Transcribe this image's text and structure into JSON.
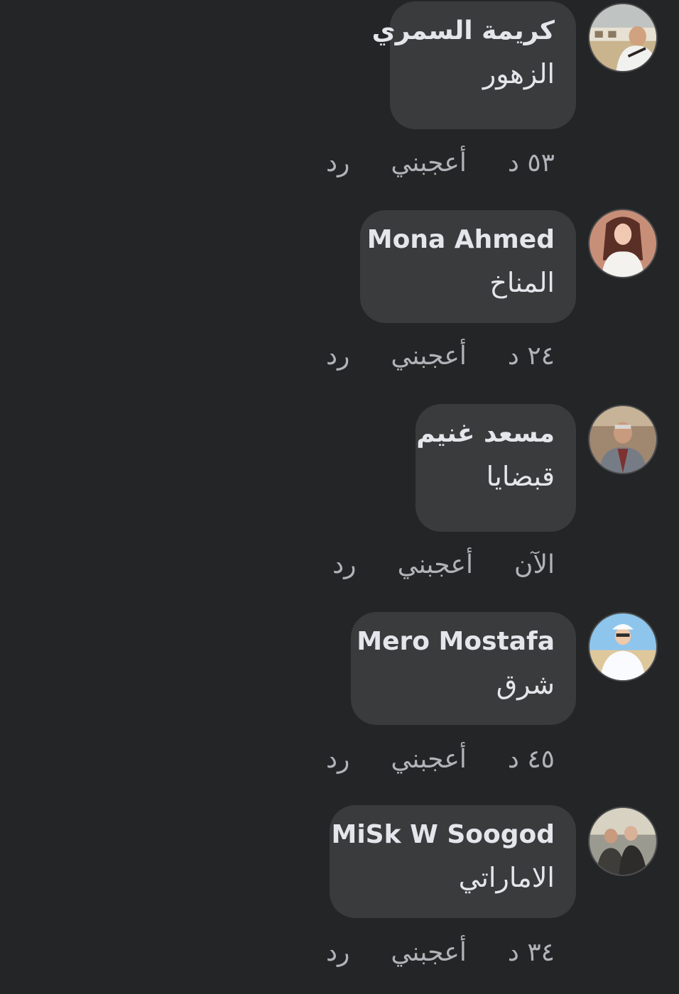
{
  "comments": [
    {
      "author": "كريمة السمري",
      "text": "الزهور",
      "time": "٥٣ د",
      "like": "أعجبني",
      "reply": "رد",
      "avatar_icon": "avatar-photo-mecca",
      "avatar_colors": [
        "#c9b48d",
        "#f1f1ef",
        "#5b5045"
      ]
    },
    {
      "author": "Mona Ahmed",
      "text": "المناخ",
      "time": "٢٤ د",
      "like": "أعجبني",
      "reply": "رد",
      "avatar_icon": "avatar-photo-woman",
      "avatar_colors": [
        "#c88f78",
        "#f4f2ee",
        "#5a2f26"
      ]
    },
    {
      "author": "مسعد غنيم",
      "text": "قبضايا",
      "time": "الآن",
      "like": "أعجبني",
      "reply": "رد",
      "avatar_icon": "avatar-photo-man",
      "avatar_colors": [
        "#a08770",
        "#767c86",
        "#7d3130"
      ]
    },
    {
      "author": "Mero Mostafa",
      "text": "شرق",
      "time": "٤٥ د",
      "like": "أعجبني",
      "reply": "رد",
      "avatar_icon": "avatar-photo-beach",
      "avatar_colors": [
        "#8ec5ec",
        "#dfc79c",
        "#f9fbff"
      ]
    },
    {
      "author": "MiSk W Soogod",
      "text": "الاماراتي",
      "time": "٣٤ د",
      "like": "أعجبني",
      "reply": "رد",
      "avatar_icon": "avatar-photo-group",
      "avatar_colors": [
        "#9b9a90",
        "#3f3d3a",
        "#d8d2c3"
      ]
    }
  ]
}
